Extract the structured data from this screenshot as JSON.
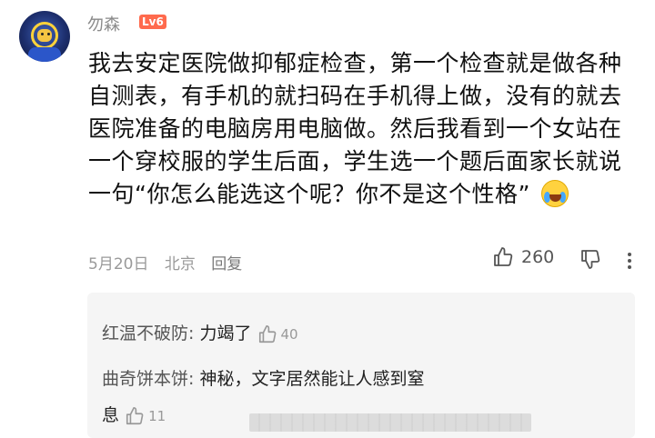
{
  "comment": {
    "username": "勿森",
    "level": "Lv6",
    "lines": [
      "我去安定医院做抑郁症检查，第一个检查就是做各种",
      "自测表，有手机的就扫码在手机得上做，没有的就去",
      "医院准备的电脑房用电脑做。然后我看到一个女站在",
      "一个穿校服的学生后面，学生选一个题后面家长就说",
      "一句“你怎么能选这个呢？你不是这个性格”"
    ],
    "emoji": "crying-laughing-emoji",
    "date": "5月20日",
    "location": "北京",
    "reply_label": "回复",
    "like_count": "260"
  },
  "replies": [
    {
      "author": "红温不破防:",
      "text": " 力竭了",
      "likes": "40"
    },
    {
      "author": "曲奇饼本饼:",
      "text": " 神秘，文字居然能让人感到窒",
      "text2": "息",
      "likes": "11"
    }
  ],
  "colors": {
    "level_badge": "#ff6a4d",
    "reply_bg": "#f5f5f5"
  }
}
